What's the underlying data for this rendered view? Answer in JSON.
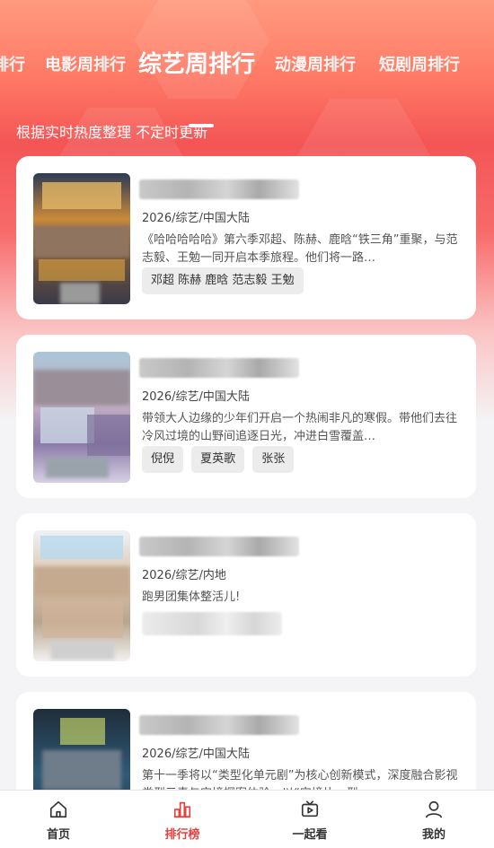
{
  "tabs": [
    {
      "label": "排行"
    },
    {
      "label": "电影周排行"
    },
    {
      "label": "综艺周排行",
      "active": true
    },
    {
      "label": "动漫周排行"
    },
    {
      "label": "短剧周排行"
    }
  ],
  "subtitle": "根据实时热度整理 不定时更新",
  "cards": [
    {
      "meta": "2026/综艺/中国大陆",
      "description": "《哈哈哈哈哈》第六季邓超、陈赫、鹿晗“铁三角”重聚，与范志毅、王勉一同开启本季旅程。他们将一路…",
      "cast": [
        "邓超 陈赫 鹿晗 范志毅 王勉"
      ]
    },
    {
      "meta": "2026/综艺/中国大陆",
      "description": "带领大人边缘的少年们开启一个热闹非凡的寒假。带他们去往冷风过境的山野间追逐日光，冲进白雪覆盖…",
      "cast": [
        "倪倪",
        "夏英歌",
        "张张"
      ]
    },
    {
      "meta": "2026/综艺/内地",
      "description": "跑男团集体整活儿!",
      "cast": []
    },
    {
      "meta": "2026/综艺/中国大陆",
      "description": "第十一季将以“类型化单元剧”为核心创新模式，深度融合影视类型元素与实境探案体验，以“实境片、型…",
      "cast": []
    }
  ],
  "bottom_nav": [
    {
      "label": "首页",
      "icon": "home-icon"
    },
    {
      "label": "排行榜",
      "icon": "chart-icon",
      "active": true
    },
    {
      "label": "一起看",
      "icon": "tv-icon"
    },
    {
      "label": "我的",
      "icon": "user-icon"
    }
  ],
  "colors": {
    "accent": "#e8403d",
    "hero_top": "#ff9a7e",
    "hero_mid": "#f45555"
  }
}
